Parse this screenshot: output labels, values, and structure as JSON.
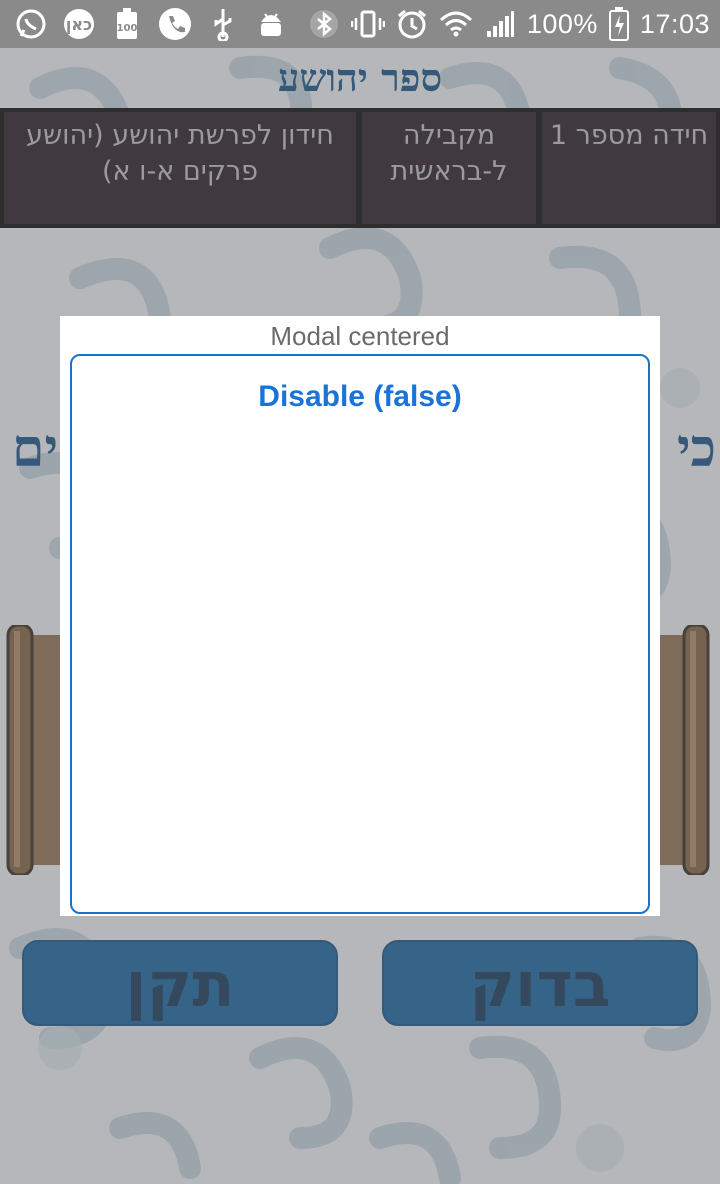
{
  "status_bar": {
    "battery_percent": "100%",
    "time": "17:03",
    "left_icons": [
      "whatsapp-icon",
      "kan-icon",
      "battery-100-icon",
      "phone-icon",
      "usb-icon",
      "android-debug-icon"
    ],
    "right_icons": [
      "bluetooth-icon",
      "vibrate-icon",
      "alarm-icon",
      "wifi-icon",
      "signal-icon",
      "battery-charging-icon"
    ]
  },
  "header": {
    "book_title": "ספר יהושע"
  },
  "info_table": {
    "riddle_number": "חידה מספר 1",
    "parallel": "מקבילה ל-בראשית",
    "quiz_name": "חידון לפרשת יהושע (יהושע פרקים א-ו א)"
  },
  "background_riddle": {
    "left_fragment": "ים",
    "right_fragment": "כי"
  },
  "buttons": {
    "fix_label": "תקן",
    "check_label": "בדוק"
  },
  "modal": {
    "title": "Modal centered",
    "inner_label": "Disable (false)"
  },
  "colors": {
    "title_blue": "#0b4a86",
    "button_blue": "#0e5d9c",
    "modal_accent": "#1a73c9",
    "table_cell_bg": "#1f1420"
  }
}
